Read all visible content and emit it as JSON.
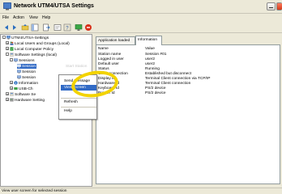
{
  "window": {
    "title": "Network UTM4/UTSA Settings"
  },
  "menu": [
    "File",
    "Action",
    "View",
    "Help"
  ],
  "toolbar_icons": [
    "back-icon",
    "forward-icon",
    "up-folder-icon",
    "show-tree-icon",
    "export-icon",
    "properties-icon",
    "help-icon",
    "monitor-icon",
    "stop-icon"
  ],
  "tree": [
    {
      "label": "UTM4/UTSA-Settings",
      "depth": 0,
      "expander": "-",
      "icon": "computer-icon"
    },
    {
      "label": "Local Users and Groups (Local)",
      "depth": 1,
      "expander": "+",
      "icon": "users-icon"
    },
    {
      "label": "Local Computer Policy",
      "depth": 1,
      "expander": "+",
      "icon": "policy-icon"
    },
    {
      "label": "Software Settings (local)",
      "depth": 1,
      "expander": "-",
      "icon": "software-icon"
    },
    {
      "label": "Sessions",
      "depth": 2,
      "expander": "-",
      "icon": "sessions-icon"
    },
    {
      "label": "Session",
      "depth": 3,
      "expander": "",
      "icon": "session-icon"
    },
    {
      "label": "Session",
      "depth": 3,
      "expander": "",
      "icon": "session-icon"
    },
    {
      "label": "Session",
      "depth": 3,
      "expander": "",
      "icon": "session-icon"
    },
    {
      "label": "Information",
      "depth": 2,
      "expander": "+",
      "icon": "information-icon"
    },
    {
      "label": "USB-Ch",
      "depth": 2,
      "expander": "+",
      "icon": "usb-icon"
    },
    {
      "label": "Software Se",
      "depth": 1,
      "expander": "+",
      "icon": "software-icon"
    },
    {
      "label": "Hardware Setting",
      "depth": 1,
      "expander": "+",
      "icon": "hardware-icon"
    }
  ],
  "tabs": [
    "Application loaded",
    "Information"
  ],
  "table": {
    "headers": [
      "Name",
      "Value"
    ],
    "rows": [
      [
        "Station name",
        "Session #01"
      ],
      [
        "Logged in user",
        "user2"
      ],
      [
        "Default user",
        "user2"
      ],
      [
        "Status",
        "Running"
      ],
      [
        "Client connection",
        "Established but disconnect"
      ],
      [
        "Display Id",
        "Terminal Client connection via TCP/IP"
      ],
      [
        "Hardware Id",
        "Terminal Client connection"
      ],
      [
        "Keyboard Id",
        "PS/2 device"
      ],
      [
        "Pointer Id",
        "PS/2 device"
      ]
    ]
  },
  "context_menu": {
    "ghost_item": "Start Station",
    "items": [
      "Send Message",
      "View Screen",
      "Refresh",
      "Help"
    ]
  },
  "status": "View user screen for selected session",
  "colors": {
    "highlight_ring": "#f3d300",
    "selection": "#316ac5",
    "chrome": "#ece9d8"
  }
}
